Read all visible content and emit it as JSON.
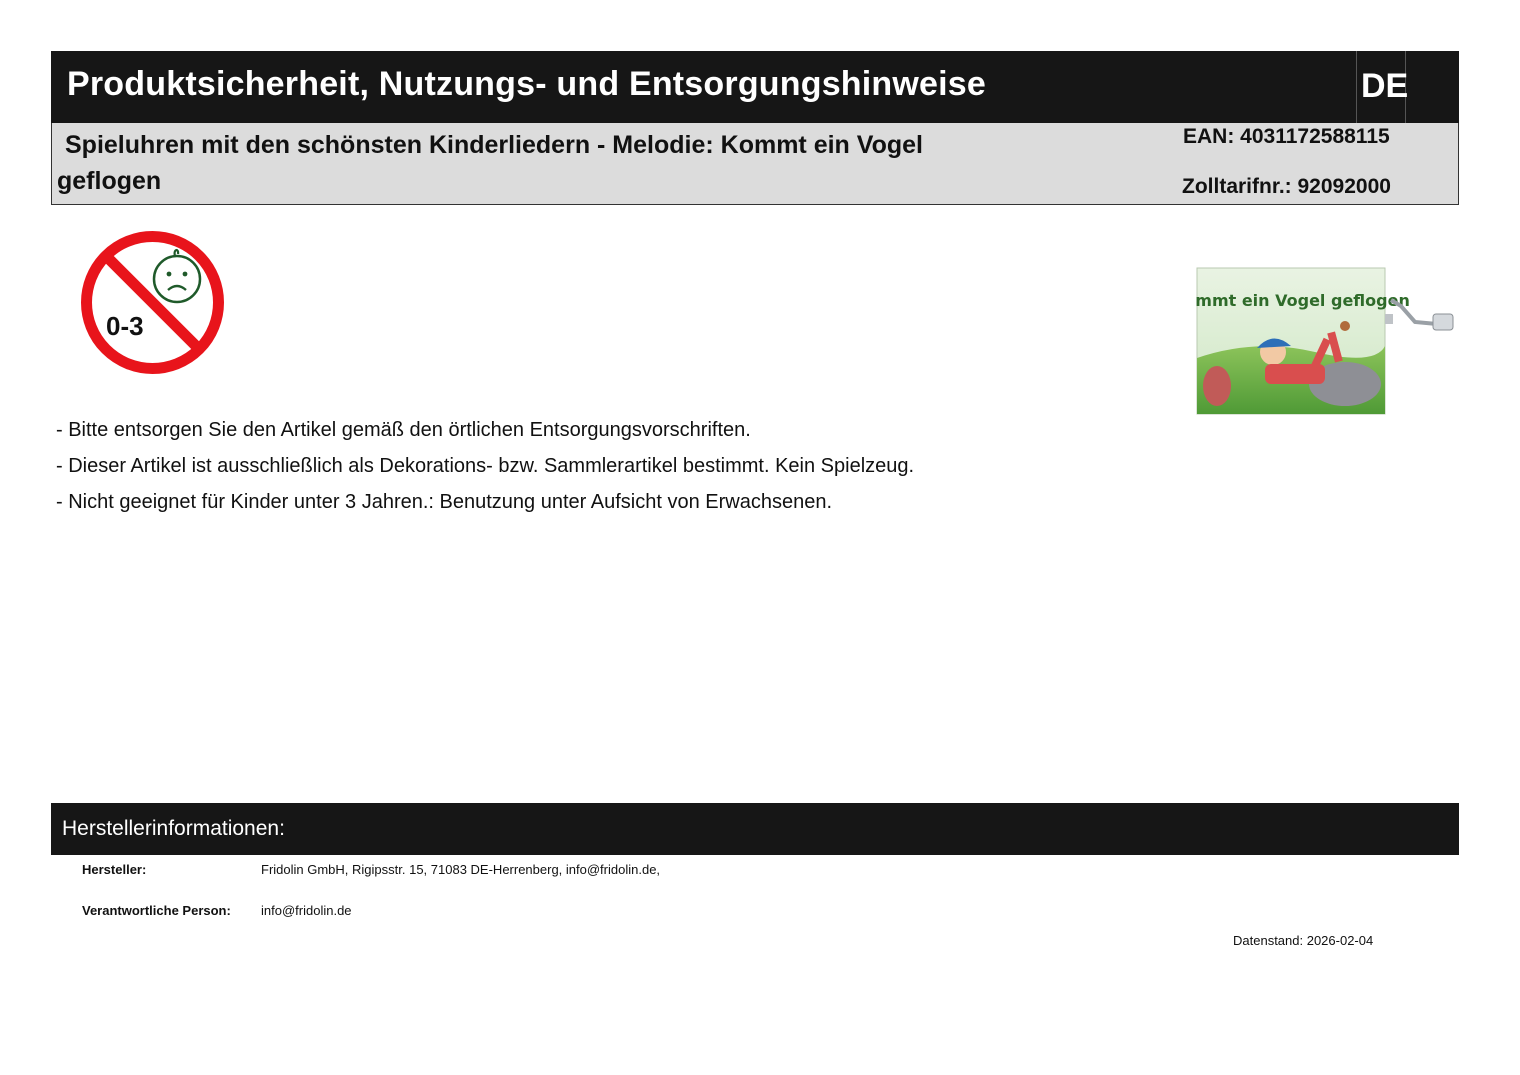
{
  "header": {
    "title": "Produktsicherheit, Nutzungs- und Entsorgungshinweise",
    "language": "DE"
  },
  "product": {
    "name": "Spieluhren mit den schönsten Kinderliedern - Melodie: Kommt ein Vogel geflogen",
    "ean": "EAN: 4031172588115",
    "zolltarif": "Zolltarifnr.: 92092000"
  },
  "age_warning": {
    "icon": "not-for-children-0-3-icon",
    "label": "0-3"
  },
  "product_image": {
    "icon": "music-box-product-image",
    "label": "Kommt ein Vogel geflogen"
  },
  "notes": [
    "- Bitte entsorgen Sie den Artikel gemäß den örtlichen Entsorgungsvorschriften.",
    "- Dieser Artikel ist ausschließlich als Dekorations- bzw. Sammlerartikel bestimmt. Kein Spielzeug.",
    "- Nicht geeignet für Kinder unter 3 Jahren.: Benutzung unter Aufsicht von Erwachsenen."
  ],
  "manufacturer": {
    "section_title": "Herstellerinformationen:",
    "hersteller_label": "Hersteller:",
    "hersteller_value": "Fridolin GmbH, Rigipsstr. 15, 71083 DE-Herrenberg, info@fridolin.de,",
    "person_label": "Verantwortliche Person:",
    "person_value": "info@fridolin.de"
  },
  "datenstand": "Datenstand: 2026-02-04",
  "colors": {
    "header_bg": "#161616",
    "product_bar_bg": "#dcdcdc",
    "warning_red": "#e8141b",
    "face_green": "#1f5a2a"
  }
}
